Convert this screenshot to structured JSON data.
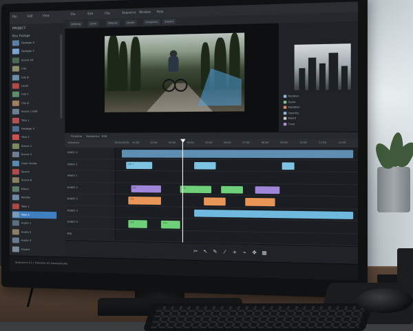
{
  "colors": {
    "clip_blue": "#7fc3e3",
    "clip_green": "#6fd07a",
    "clip_purple": "#9f86d8",
    "clip_orange": "#e89558",
    "selection": "#3f7fc0",
    "audio_bar": "#6fb9de"
  },
  "left_panel": {
    "menu": [
      "File",
      "Edit",
      "View"
    ],
    "title": "PROJECT",
    "folder": "Bins Footage",
    "items": [
      {
        "label": "Footage A",
        "thumb": "#5b7fa0"
      },
      {
        "label": "Footage 2",
        "thumb": "#7aa7d0"
      },
      {
        "label": "Scene 04",
        "thumb": "#4c6a52"
      },
      {
        "label": "Clip",
        "thumb": "#8c8f6a"
      },
      {
        "label": "Clip B",
        "thumb": "#6b8fa8"
      },
      {
        "label": "Layer",
        "thumb": "#b34848"
      },
      {
        "label": "Clip C",
        "thumb": "#5f8c6b"
      },
      {
        "label": "Clip D",
        "thumb": "#a08060"
      },
      {
        "label": "Scene 1 Edit",
        "thumb": "#6c7f8f"
      },
      {
        "label": "Title 1",
        "thumb": "#b85050"
      },
      {
        "label": "Footage 3",
        "thumb": "#4f6f8f"
      },
      {
        "label": "Title 2",
        "thumb": "#cf4e4e"
      },
      {
        "label": "Scene 2",
        "thumb": "#7d8a5e"
      },
      {
        "label": "Scene 3",
        "thumb": "#6d7e92"
      },
      {
        "label": "Color Grade",
        "thumb": "#5a8ab0"
      },
      {
        "label": "Sound",
        "thumb": "#b34a4a"
      },
      {
        "label": "Scene 6",
        "thumb": "#8a8060"
      },
      {
        "label": "Effect",
        "thumb": "#5d7d6d"
      },
      {
        "label": "Render",
        "thumb": "#6f88a6"
      },
      {
        "label": "Take 1",
        "thumb": "#b04646"
      },
      {
        "label": "Take 2",
        "thumb": "#7a9ab8",
        "selected": true
      },
      {
        "label": "Audio 1",
        "thumb": "#5c6f80"
      },
      {
        "label": "Audio 2",
        "thumb": "#8d7e64"
      },
      {
        "label": "Audio 3",
        "thumb": "#667c8e"
      },
      {
        "label": "Export",
        "thumb": "#7b8c9c"
      }
    ]
  },
  "top_menu": [
    "File",
    "Edit",
    "Clip",
    "Sequence",
    "Window",
    "Help"
  ],
  "toolbar_tabs": [
    "Editing",
    "Color",
    "Effects",
    "Audio",
    "Graphics",
    "Export"
  ],
  "inspector": {
    "rows": [
      {
        "label": "Position",
        "color": "#8fb8d8"
      },
      {
        "label": "Scale",
        "color": "#7fc38a"
      },
      {
        "label": "Rotation",
        "color": "#d88a5a"
      },
      {
        "label": "Opacity",
        "color": "#8fb8d8"
      },
      {
        "label": "Blend",
        "color": "#c8c8c8"
      },
      {
        "label": "Crop",
        "color": "#b08fd8"
      }
    ]
  },
  "timeline": {
    "tabs": [
      "Timeline",
      "Sequence",
      "Edit"
    ],
    "sequence_name": "Sequence",
    "ticks": [
      "00:00:00:00",
      "01:00",
      "02:00",
      "03:00",
      "04:00",
      "05:00",
      "06:00",
      "07:00",
      "08:00",
      "09:00",
      "10:00",
      "11:00",
      "12:00"
    ],
    "tracks": [
      "VIDEO 3",
      "VIDEO 2",
      "VIDEO 1",
      "AUDIO 1",
      "AUDIO 2",
      "AUDIO 3",
      "AUDIO 4",
      "MIX"
    ],
    "clips": [
      {
        "track": 0,
        "start": 0.03,
        "end": 0.98,
        "color": "#5e8fb3",
        "label": ""
      },
      {
        "track": 1,
        "start": 0.05,
        "end": 0.16,
        "color": "#7fc3e3",
        "label": "Clip 1"
      },
      {
        "track": 1,
        "start": 0.34,
        "end": 0.43,
        "color": "#7fc3e3",
        "label": ""
      },
      {
        "track": 1,
        "start": 0.7,
        "end": 0.75,
        "color": "#7fc3e3",
        "label": ""
      },
      {
        "track": 3,
        "start": 0.07,
        "end": 0.2,
        "color": "#9f86d8",
        "label": "Clip"
      },
      {
        "track": 3,
        "start": 0.28,
        "end": 0.41,
        "color": "#6fd07a",
        "label": "Clip"
      },
      {
        "track": 3,
        "start": 0.45,
        "end": 0.54,
        "color": "#6fd07a",
        "label": ""
      },
      {
        "track": 3,
        "start": 0.59,
        "end": 0.69,
        "color": "#9f86d8",
        "label": ""
      },
      {
        "track": 4,
        "start": 0.06,
        "end": 0.2,
        "color": "#e89558",
        "label": "Clip"
      },
      {
        "track": 4,
        "start": 0.38,
        "end": 0.47,
        "color": "#e89558",
        "label": ""
      },
      {
        "track": 4,
        "start": 0.55,
        "end": 0.67,
        "color": "#e89558",
        "label": ""
      },
      {
        "track": 5,
        "start": 0.34,
        "end": 0.98,
        "color": "#6fb9de",
        "label": ""
      },
      {
        "track": 6,
        "start": 0.06,
        "end": 0.14,
        "color": "#6fd07a",
        "label": "Clip"
      },
      {
        "track": 6,
        "start": 0.2,
        "end": 0.28,
        "color": "#6fd07a",
        "label": "Clip"
      }
    ],
    "playhead_fraction": 0.29
  },
  "controls": [
    "scissors-icon",
    "select-icon",
    "pen-icon",
    "razor-icon",
    "plus-icon",
    "link-icon",
    "move-icon",
    "grid-icon"
  ],
  "status": {
    "text": "Sequence 01  |  Timeline 02  Sound/Audio"
  }
}
